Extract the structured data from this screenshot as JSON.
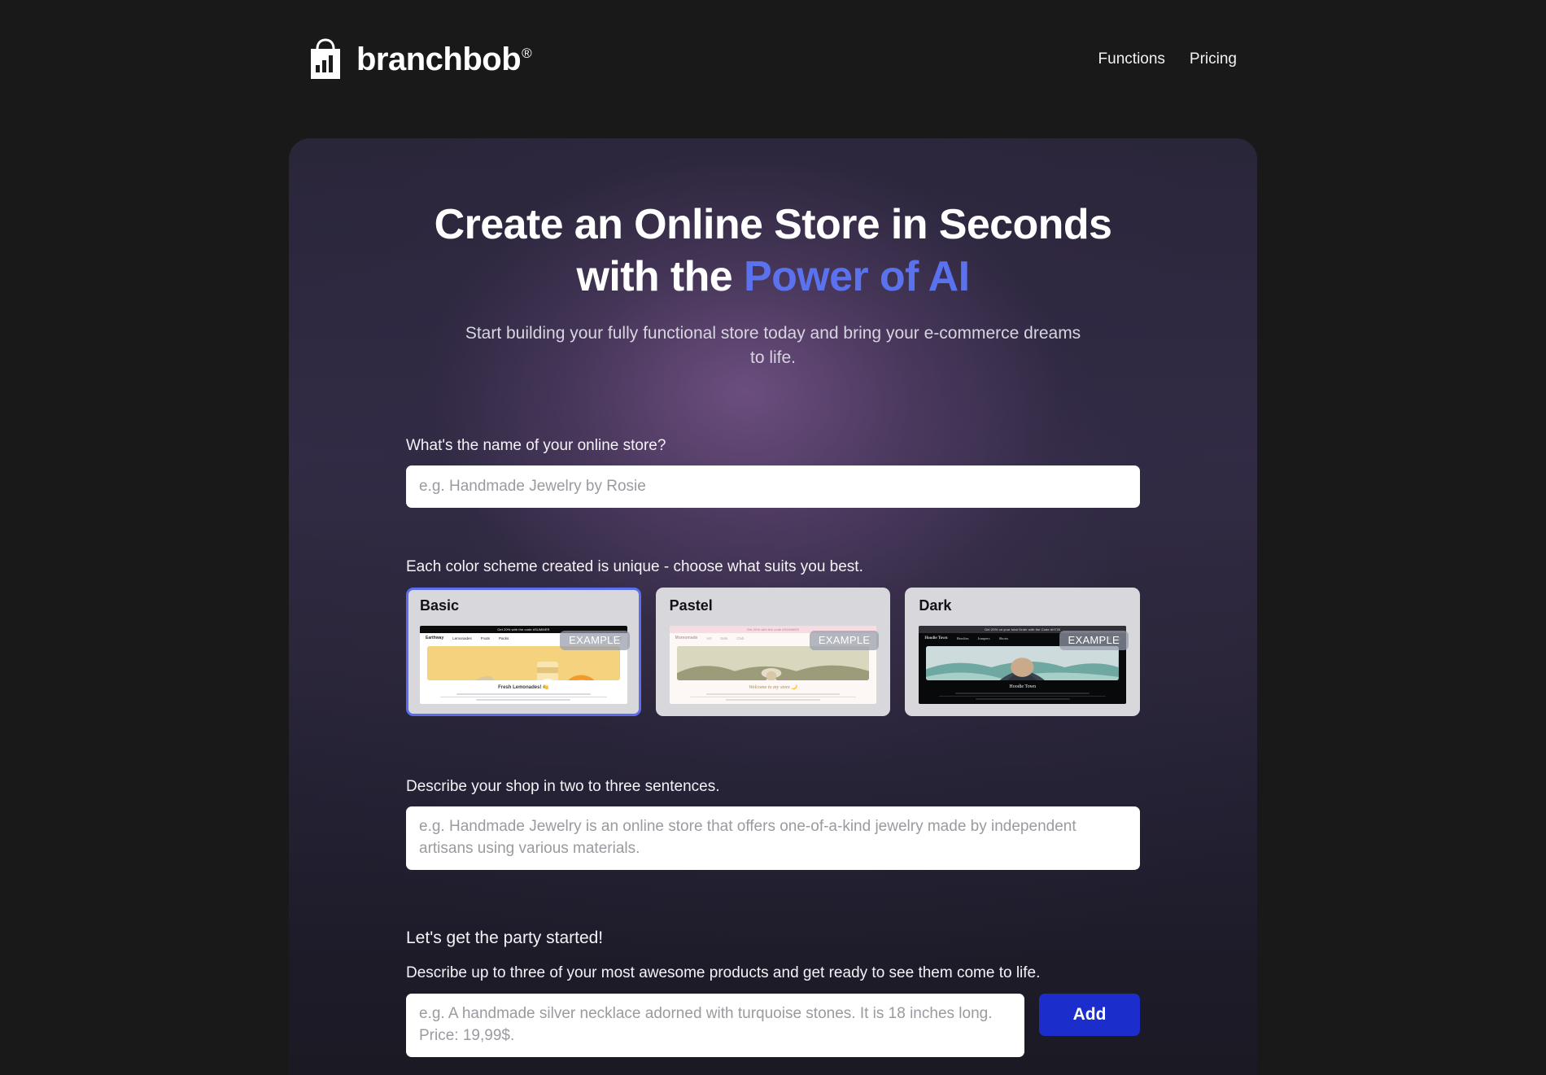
{
  "header": {
    "brand_name": "branchbob",
    "brand_trademark": "®",
    "logo_icon": "shopping-bag-chart-icon",
    "nav": [
      {
        "label": "Functions"
      },
      {
        "label": "Pricing"
      }
    ]
  },
  "hero": {
    "title_line1": "Create an Online Store in Seconds",
    "title_line2_prefix": "with the ",
    "title_accent": "Power of AI",
    "accent_color": "#5b72ef",
    "subtitle": "Start building your fully functional store today and bring your e-commerce dreams to life."
  },
  "store_name": {
    "label": "What's the name of your online store?",
    "placeholder": "e.g. Handmade Jewelry by Rosie",
    "value": ""
  },
  "color_scheme": {
    "label": "Each color scheme created is unique - choose what suits you best.",
    "selected": "Basic",
    "selected_border_color": "#5b6ef0",
    "example_badge": "EXAMPLE",
    "options": [
      {
        "name": "Basic",
        "selected": true,
        "preview": {
          "promo": "Get 20% with the code #SUMMER",
          "brand": "Earthway",
          "nav": [
            "Lemonades",
            "Fruits",
            "Packs"
          ],
          "heading": "Fresh Lemonades! 🍋"
        }
      },
      {
        "name": "Pastel",
        "selected": false,
        "preview": {
          "promo": "Get 20% with the code #SUMMER",
          "brand": "Momomade",
          "nav": [
            "Art",
            "Sets",
            "Club"
          ],
          "heading": "Welcome to my store 🌙"
        }
      },
      {
        "name": "Dark",
        "selected": false,
        "preview": {
          "promo": "Get 20% on your total Order with the Code #HT20",
          "brand": "Hoodie Town",
          "nav": [
            "Hoodies",
            "Jumpers",
            "Shorts"
          ],
          "heading": "Hoodie Town"
        }
      }
    ]
  },
  "describe": {
    "label": "Describe your shop in two to three sentences.",
    "placeholder": "e.g. Handmade Jewelry is an online store that offers one-of-a-kind jewelry made by independent artisans using various materials.",
    "value": ""
  },
  "products": {
    "title": "Let's get the party started!",
    "subtitle": "Describe up to three of your most awesome products and get ready to see them come to life.",
    "placeholder": "e.g. A handmade silver necklace adorned with turquoise stones. It is 18 inches long. Price: 19,99$.",
    "value": "",
    "add_label": "Add",
    "add_color": "#1b2ecb"
  }
}
